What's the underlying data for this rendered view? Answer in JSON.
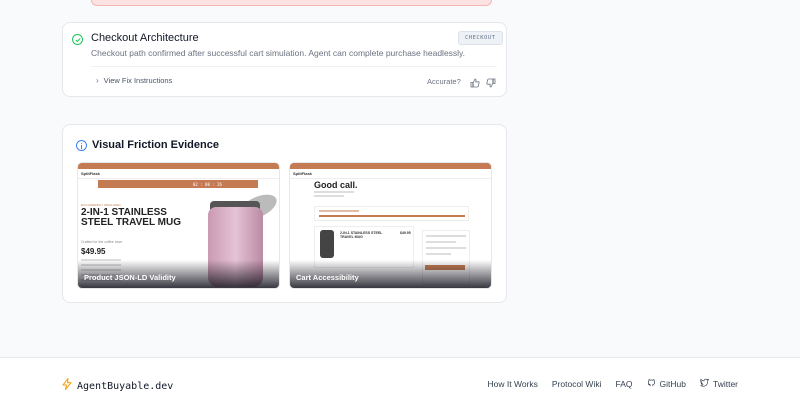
{
  "checkout": {
    "title": "Checkout Architecture",
    "badge": "CHECKOUT",
    "description": "Checkout path confirmed after successful cart simulation. Agent can complete purchase headlessly.",
    "fix_link": "View Fix Instructions",
    "accurate_label": "Accurate?"
  },
  "friction": {
    "title": "Visual Friction Evidence",
    "screenshots": [
      {
        "caption": "Product JSON-LD Validity",
        "logo": "SplitFlask",
        "timer": "02 : 08 : 26",
        "tag": "ECO-FRIENDLY INSULATED",
        "heading": "2-IN-1 STAINLESS STEEL TRAVEL MUG",
        "subtitle": "Crafted for the coffee lover",
        "price": "$49.95"
      },
      {
        "caption": "Cart Accessibility",
        "logo": "SplitFlask",
        "heading": "Good call.",
        "item_name": "2-IN-1 STAINLESS STEEL TRAVEL MUG",
        "item_price": "$49.95"
      }
    ]
  },
  "footer": {
    "brand": "AgentBuyable.dev",
    "links": [
      {
        "label": "How It Works"
      },
      {
        "label": "Protocol Wiki"
      },
      {
        "label": "FAQ"
      },
      {
        "label": "GitHub"
      },
      {
        "label": "Twitter"
      }
    ]
  },
  "colors": {
    "success": "#22c55e",
    "info": "#3b82f6",
    "brand_accent": "#f59e0b",
    "store_accent": "#c47a52"
  }
}
